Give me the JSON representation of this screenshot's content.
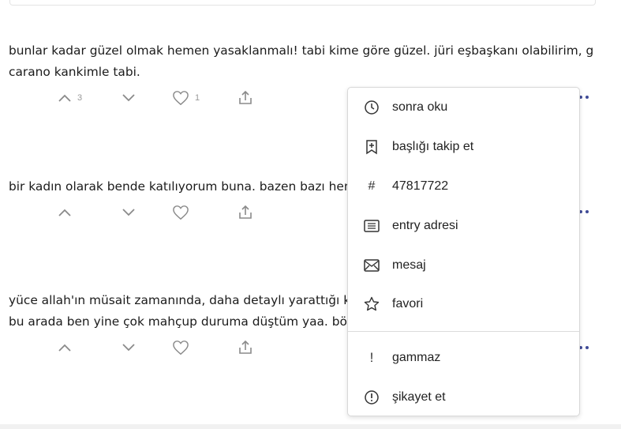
{
  "entries": [
    {
      "text_lines": [
        "bunlar kadar güzel olmak hemen yasaklanmalı! tabi kime göre güzel. jüri eşbaşkanı olabilirim, gina",
        "carano kankimle tabi."
      ],
      "upvote_count": "3",
      "fav_count": "1"
    },
    {
      "text_lines": [
        "bir kadın olarak bende katılıyorum buna. bazen bazı hemc"
      ],
      "upvote_count": "",
      "fav_count": ""
    },
    {
      "text_lines": [
        "yüce allah'ın müsait zamanında, daha detaylı yarattığı kad",
        "bu arada ben yine çok mahçup duruma düştüm yaa. böyle"
      ],
      "upvote_count": "",
      "fav_count": ""
    }
  ],
  "menu": {
    "items": [
      {
        "label": "sonra oku",
        "icon": "clock-icon"
      },
      {
        "label": "başlığı takip et",
        "icon": "bookmark-plus-icon"
      },
      {
        "label": "47817722",
        "icon": "hash-icon",
        "glyph": "#"
      },
      {
        "label": "entry adresi",
        "icon": "list-icon"
      },
      {
        "label": "mesaj",
        "icon": "envelope-icon"
      },
      {
        "label": "favori",
        "icon": "star-icon"
      },
      {
        "label": "gammaz",
        "icon": "exclamation-icon",
        "glyph": "!"
      },
      {
        "label": "şikayet et",
        "icon": "alert-circle-icon"
      }
    ]
  },
  "colors": {
    "accent_dots": "#3f4a96",
    "icon_gray": "#8a8a8a",
    "text": "#1b1b1b"
  }
}
